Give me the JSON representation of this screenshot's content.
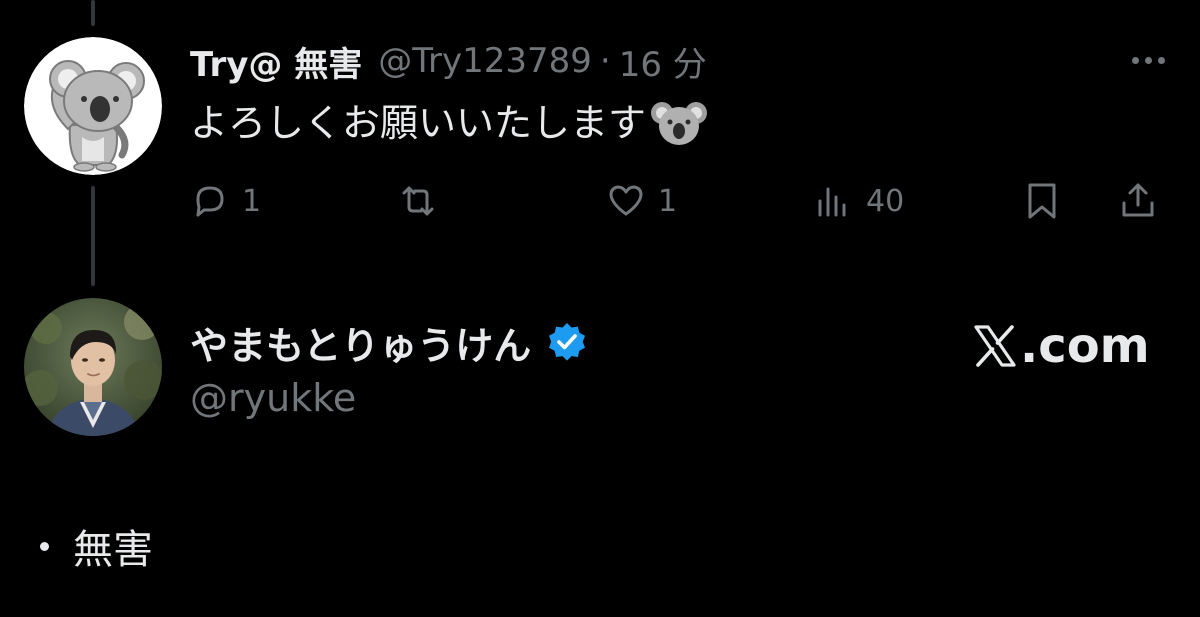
{
  "reply": {
    "display_name": "Try@ 無害",
    "handle": "@Try123789",
    "separator": "·",
    "timestamp": "16 分",
    "text": "よろしくお願いいたします",
    "emoji_icon": "koala-emoji-icon",
    "avatar_icon": "koala-avatar",
    "actions": {
      "reply_count": "1",
      "repost_count": "",
      "like_count": "1",
      "views_count": "40"
    }
  },
  "quoted": {
    "display_name": "やまもとりゅうけん",
    "handle": "@ryukke",
    "verified": true,
    "verified_color": "#1d9bf0",
    "avatar_icon": "person-photo-avatar"
  },
  "brand": {
    "label": ".com",
    "logo_icon": "x-logo-icon"
  },
  "body": {
    "bullet_text": "無害"
  },
  "colors": {
    "background": "#000000",
    "primary_text": "#e7e9ea",
    "secondary_text": "#71767b",
    "thread_line": "#333639",
    "verified_blue": "#1d9bf0"
  }
}
